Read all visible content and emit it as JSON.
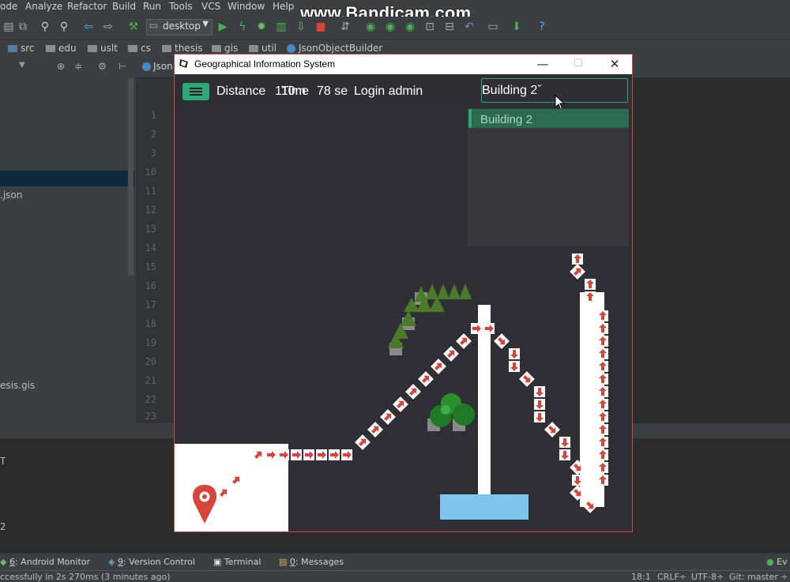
{
  "ide": {
    "menu": [
      "ode",
      "Analyze",
      "Refactor",
      "Build",
      "Run",
      "Tools",
      "VCS",
      "Window",
      "Help"
    ],
    "run_config": "desktop",
    "breadcrumbs": [
      "src",
      "edu",
      "uslt",
      "cs",
      "thesis",
      "gis",
      "util",
      "JsonObjectBuilder"
    ],
    "editor_tab": "Json",
    "line_numbers": [
      "1",
      "2",
      "3",
      "10",
      "11",
      "12",
      "13",
      "14",
      "15",
      "16",
      "17",
      "18",
      "19",
      "20",
      "21",
      "22",
      "23"
    ],
    "tree_items": [
      ".json",
      "esis.gis"
    ],
    "bottom_left_chars": [
      "T",
      "2"
    ],
    "tool_windows": {
      "android_monitor": {
        "key": "6",
        "label": ": Android Monitor"
      },
      "version_control": {
        "key": "9",
        "label": ": Version Control"
      },
      "terminal": {
        "label": "Terminal"
      },
      "messages": {
        "key": "0",
        "label": ": Messages"
      }
    },
    "event_log": "Ev",
    "status": {
      "message": "ccessfully in 2s 270ms (3 minutes ago)",
      "position": "18:1",
      "line_sep": "CRLF÷",
      "encoding": "UTF-8÷",
      "vcs": "Git: master ÷"
    }
  },
  "watermark": "www.Bandicam.com",
  "app": {
    "title": "Geographical Information System",
    "controls": {
      "minimize": "—",
      "maximize": "☐",
      "close": "✕"
    },
    "header": {
      "distance_label": "Distance",
      "distance_value": "110m",
      "time_label": "Time",
      "time_value": "78 se",
      "login_label": "Login admin"
    },
    "search": {
      "value": "Building 2"
    },
    "dropdown": [
      "Building 2"
    ],
    "colors": {
      "accent": "#2aa876",
      "path": "#d9443a",
      "building": "#7ec4ec",
      "map_bg": "#2f2f35",
      "roof": "#ffffff"
    }
  }
}
